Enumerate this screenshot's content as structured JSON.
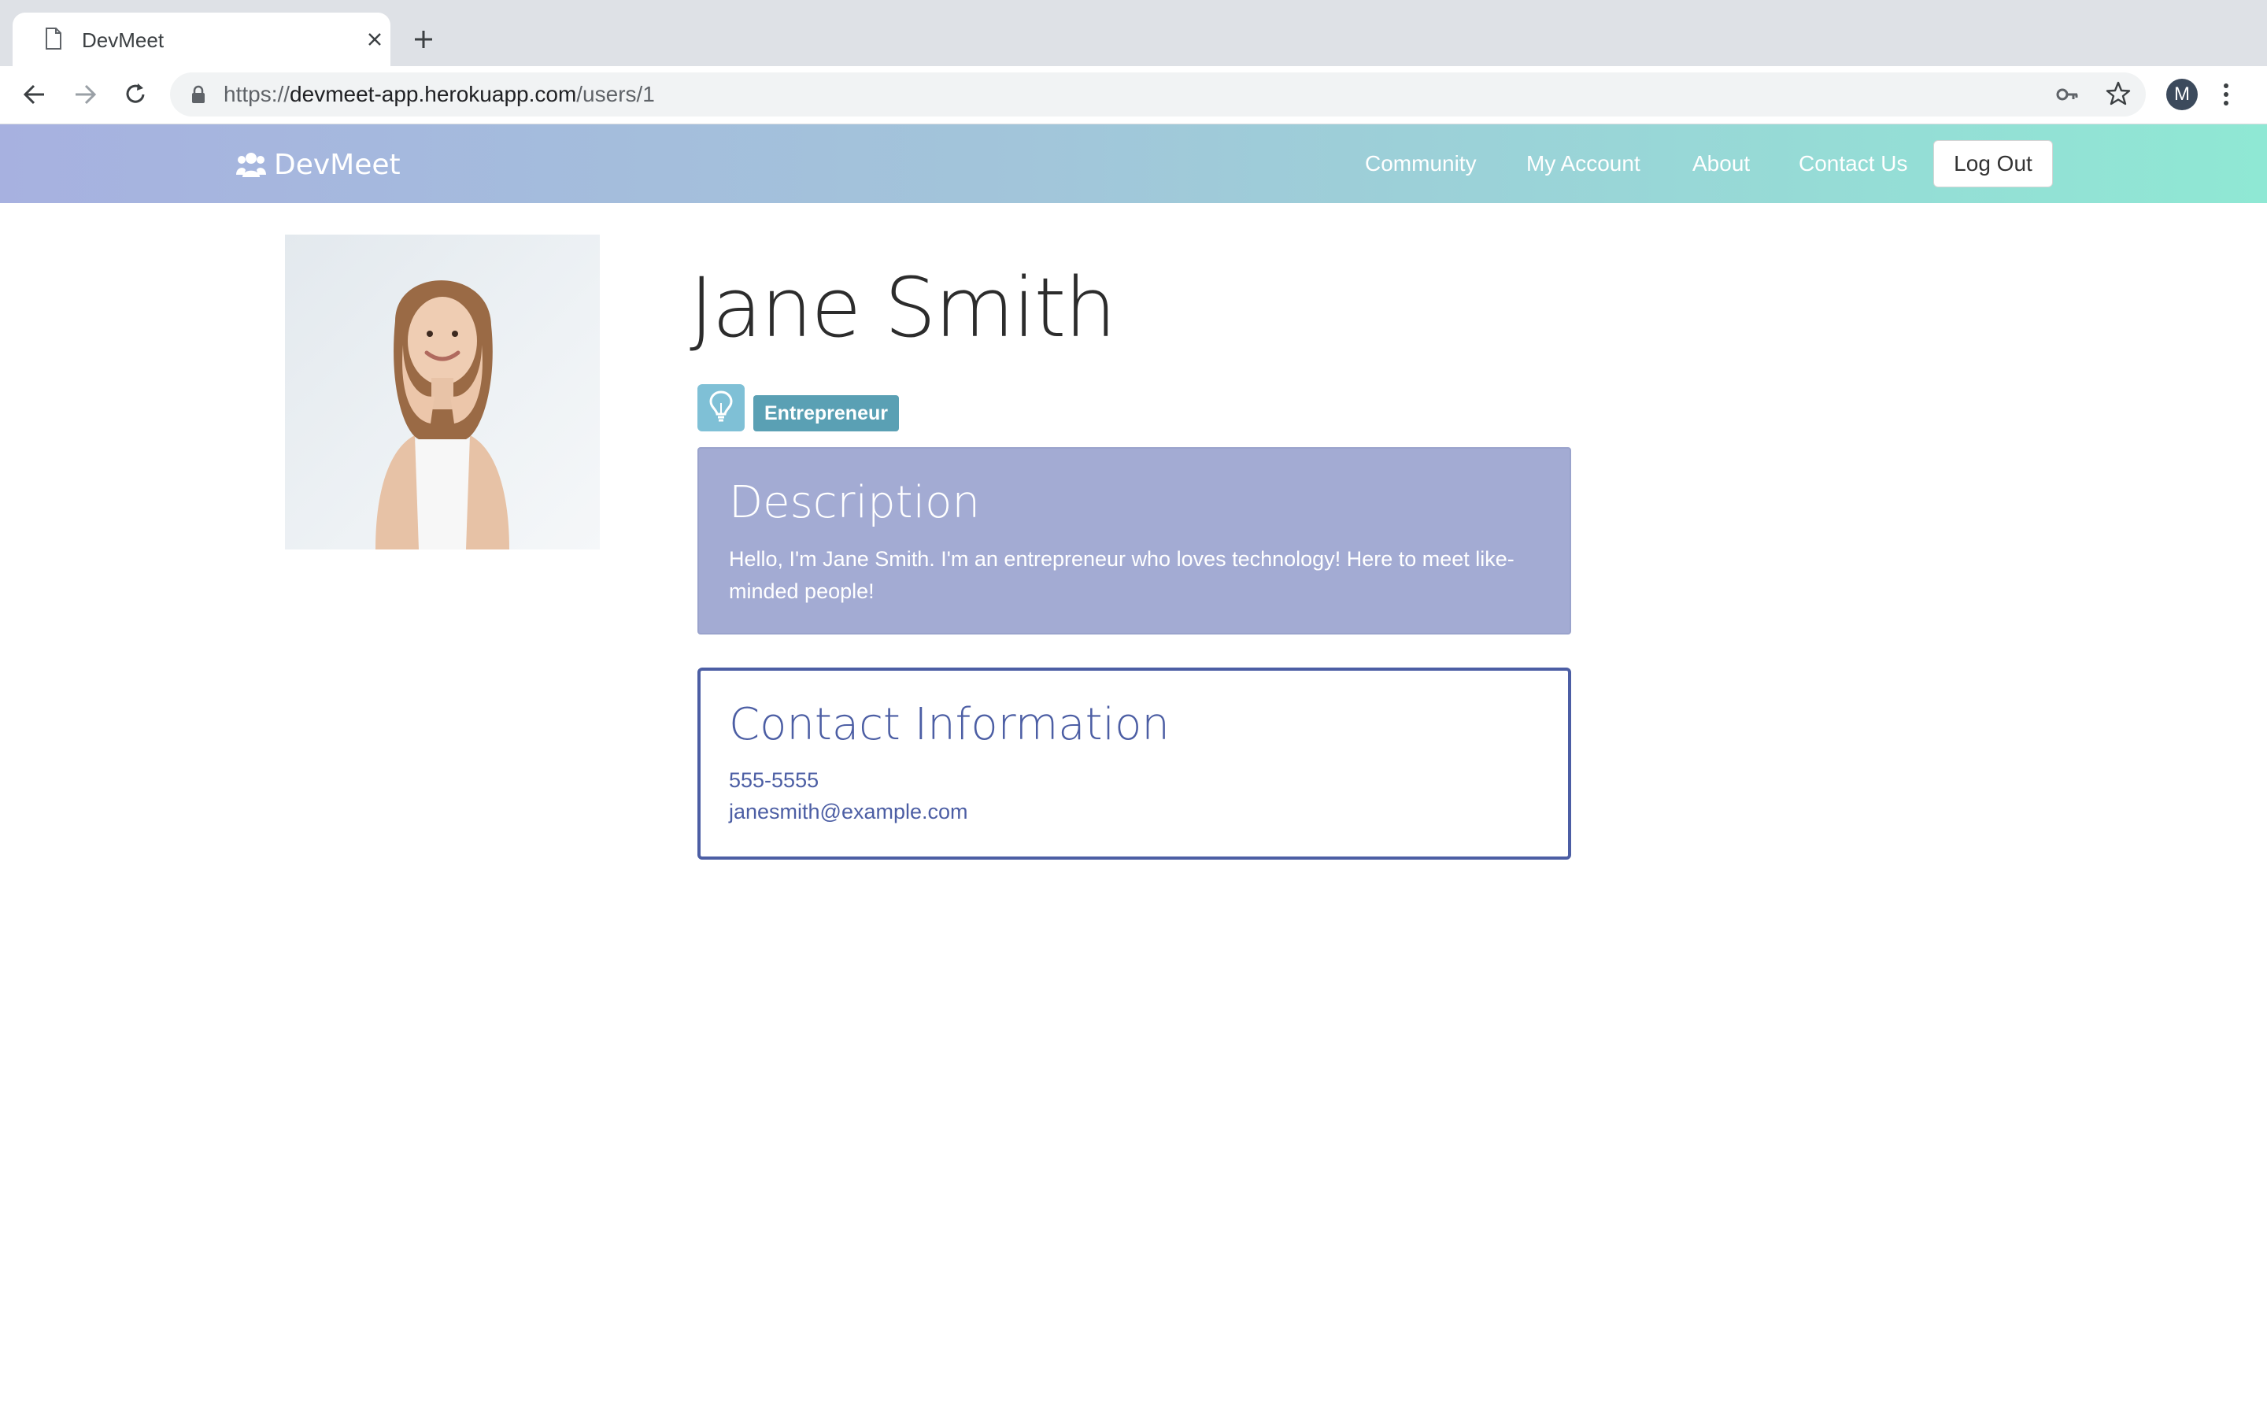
{
  "browser": {
    "tab_title": "DevMeet",
    "url_prefix": "https://",
    "url_host": "devmeet-app.herokuapp.com",
    "url_path": "/users/1",
    "profile_initial": "M"
  },
  "site": {
    "brand": "DevMeet",
    "nav": {
      "community": "Community",
      "my_account": "My Account",
      "about": "About",
      "contact_us": "Contact Us",
      "logout": "Log Out"
    }
  },
  "profile": {
    "name": "Jane Smith",
    "role_icon": "lightbulb-icon",
    "role": "Entrepreneur",
    "description_title": "Description",
    "description": "Hello, I'm Jane Smith. I'm an entrepreneur who loves technology! Here to meet like-minded people!",
    "contact_title": "Contact Information",
    "phone": "555-5555",
    "email": "janesmith@example.com"
  },
  "colors": {
    "navbar_gradient_start": "#a7b1e0",
    "navbar_gradient_end": "#8fe8d4",
    "description_card": "#a3abd3",
    "contact_accent": "#4c5ea4",
    "badge": "#5aa0b4"
  }
}
